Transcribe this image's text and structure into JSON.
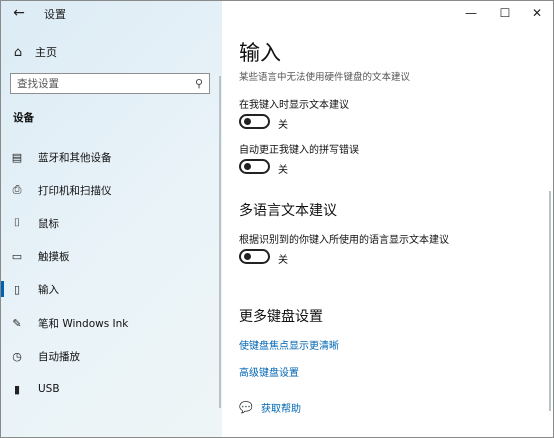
{
  "app": {
    "title": "设置",
    "back_glyph": "←"
  },
  "window_controls": {
    "minimize": "—",
    "maximize": "☐",
    "close": "✕"
  },
  "sidebar": {
    "home_label": "主页",
    "search_placeholder": "查找设置",
    "section": "设备",
    "items": [
      {
        "label": "蓝牙和其他设备",
        "icon": "bluetooth-devices-icon",
        "glyph": "▤",
        "active": false
      },
      {
        "label": "打印机和扫描仪",
        "icon": "printer-icon",
        "glyph": "⎙",
        "active": false
      },
      {
        "label": "鼠标",
        "icon": "mouse-icon",
        "glyph": "⌷",
        "active": false
      },
      {
        "label": "触摸板",
        "icon": "touchpad-icon",
        "glyph": "▭",
        "active": false
      },
      {
        "label": "输入",
        "icon": "keyboard-icon",
        "glyph": "▯",
        "active": true
      },
      {
        "label": "笔和 Windows Ink",
        "icon": "pen-icon",
        "glyph": "✎",
        "active": false
      },
      {
        "label": "自动播放",
        "icon": "autoplay-icon",
        "glyph": "◷",
        "active": false
      },
      {
        "label": "USB",
        "icon": "usb-icon",
        "glyph": "▮",
        "active": false
      }
    ]
  },
  "main": {
    "title": "输入",
    "description": "某些语言中无法使用硬件键盘的文本建议",
    "settings": [
      {
        "label": "在我键入时显示文本建议",
        "state": "关"
      },
      {
        "label": "自动更正我键入的拼写错误",
        "state": "关"
      }
    ],
    "multilang": {
      "title": "多语言文本建议",
      "label": "根据识别到的你键入所使用的语言显示文本建议",
      "state": "关"
    },
    "more": {
      "title": "更多键盘设置",
      "links": [
        "使键盘焦点显示更清晰",
        "高级键盘设置"
      ]
    },
    "help_label": "获取帮助"
  },
  "colors": {
    "accent": "#0063b1",
    "link": "#0066b4"
  }
}
